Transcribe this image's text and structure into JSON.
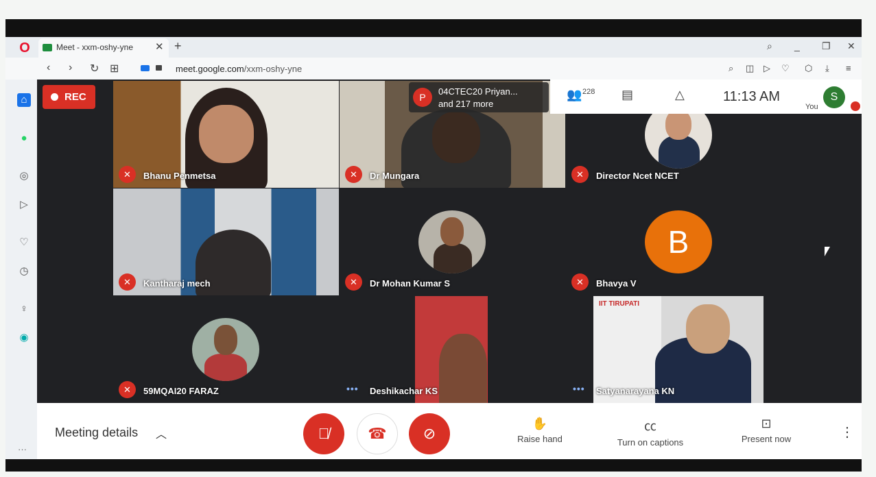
{
  "browser": {
    "tab_title": "Meet - xxm-oshy-yne",
    "tab_close": "✕",
    "new_tab": "+",
    "url_domain": "meet.google.com",
    "url_path": "/xxm-oshy-yne"
  },
  "recording": {
    "label": "REC"
  },
  "participants": [
    {
      "name": "Bhanu Penmetsa",
      "muted": true
    },
    {
      "name": "Dr Mungara",
      "muted": true
    },
    {
      "name": "Director Ncet NCET",
      "muted": true
    },
    {
      "name": "Kantharaj mech",
      "muted": true
    },
    {
      "name": "Dr Mohan Kumar S",
      "muted": true
    },
    {
      "name": "Bhavya V",
      "muted": true,
      "avatar_letter": "B"
    },
    {
      "name": "59MQAI20 FARAZ",
      "muted": true
    },
    {
      "name": "Deshikachar KS",
      "muted": false
    },
    {
      "name": "Satyanarayana KN",
      "muted": false
    }
  ],
  "presenter_card": {
    "avatar_letter": "P",
    "line1": "04CTEC20 Priyan...",
    "line2": "and 217 more"
  },
  "topbar": {
    "people_count": "228",
    "time": "11:13 AM",
    "you_letter": "S",
    "you_label": "You"
  },
  "bottombar": {
    "meeting_details": "Meeting details",
    "raise_hand": "Raise hand",
    "captions": "Turn on captions",
    "present": "Present now"
  },
  "colors": {
    "danger": "#d93025",
    "stage": "#202124",
    "avatar_orange": "#e8710a",
    "you_green": "#2e7d32"
  }
}
